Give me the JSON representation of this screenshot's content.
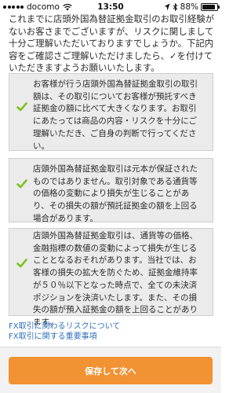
{
  "status_bar": {
    "carrier": "docomo",
    "time": "13:50",
    "battery_percent": "88%",
    "battery_level": 0.88
  },
  "intro": {
    "text": "これまでに店頭外国為替証拠金取引のお取引経験がないお客さまでございますが、リスクに関しまして十分ご理解いただいておりますでしょうか。下記内容をご確認さご理解いただけましたら、✓を付けていただきますようお願いいたします。"
  },
  "consents": [
    {
      "checked": true,
      "text": "お客様が行う店頭外国為替証拠金取引の取引額は、その取引についてお客様が預託すべき証拠金の額に比べて大きくなります。お取引にあたっては商品の内容・リスクを十分にご理解いただき、ご自身の判断で行ってください。"
    },
    {
      "checked": true,
      "text": "店頭外国為替証拠金取引は元本が保証されたものではありません。取引対象である通貨等の価格の変動により損失が生じることがあり、その損失の額が預託証拠金の額を上回る場合があります。"
    },
    {
      "checked": true,
      "text": "店頭外国為替証拠金取引は、通貨等の価格、金融指標の数値の変動によって損失が生じることとなるおそれがあります。当社では、お客様の損失の拡大を防ぐため、証拠金維持率が５０％以下となった時点で、全ての未決済ポジションを決済いたします。また、その損失の額が預入証拠金の額を上回ることがあります。"
    }
  ],
  "links": [
    "FX取引に関わるリスクについて",
    "FX取引に関する重要事項"
  ],
  "footer": {
    "submit_label": "保存して次へ"
  },
  "colors": {
    "check": "#7cc221",
    "accent_button": "#f19233",
    "link": "#2f6fbf",
    "card_bg": "#ebebeb"
  }
}
